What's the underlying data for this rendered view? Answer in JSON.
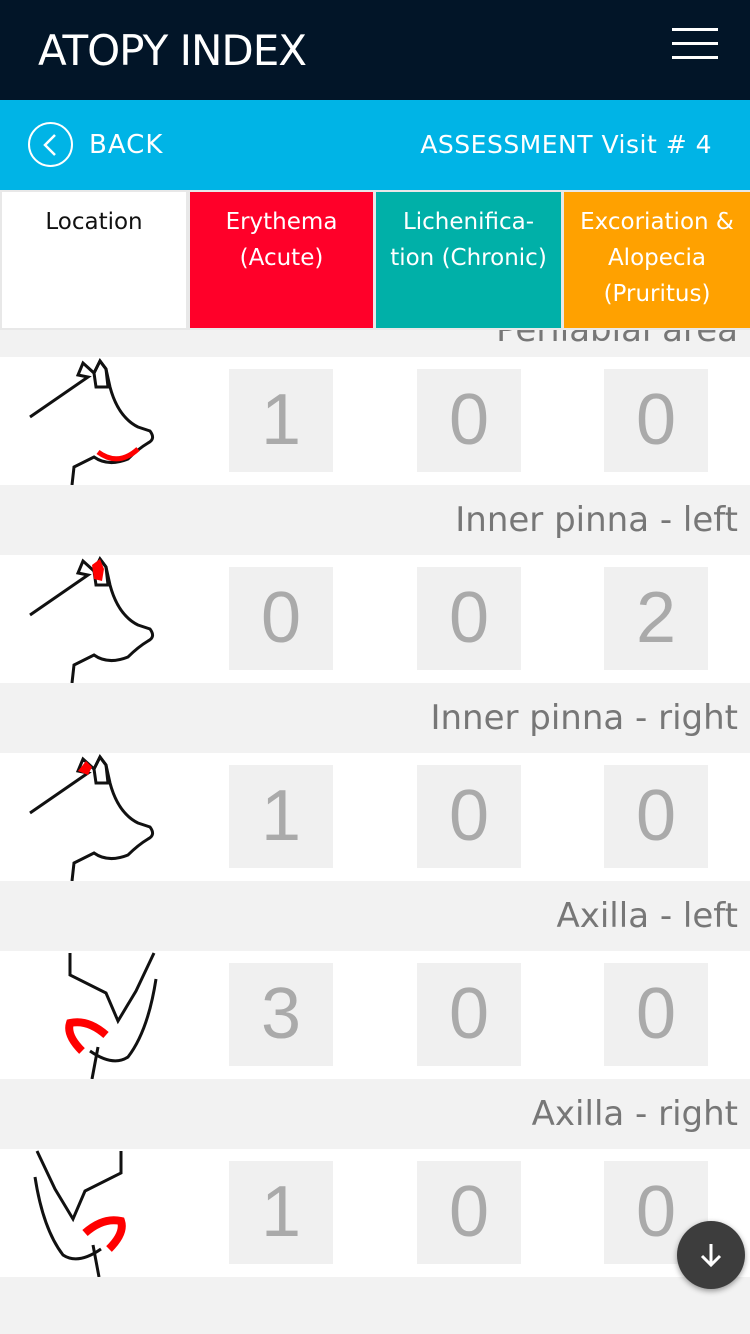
{
  "header": {
    "title": "ATOPY INDEX",
    "menu_icon": "hamburger-icon"
  },
  "nav": {
    "back_label": "BACK",
    "assessment_label": "ASSESSMENT Visit # 4"
  },
  "columns": [
    {
      "label": "Location",
      "color": "#ffffff"
    },
    {
      "label": "Erythema (Acute)",
      "color": "#ff0029"
    },
    {
      "label": "Lichenifica- tion (Chronic)",
      "color": "#00b0a8"
    },
    {
      "label": "Excoriation & Alopecia (Pruritus)",
      "color": "#ffa100"
    }
  ],
  "partial_label": "Perilabial area",
  "rows": [
    {
      "location": "Perilabial area",
      "image": "dog-head-lip",
      "values": [
        "1",
        "0",
        "0"
      ]
    },
    {
      "location": "Inner pinna - left",
      "image": "dog-head-ear-left",
      "values": [
        "0",
        "0",
        "2"
      ]
    },
    {
      "location": "Inner pinna - right",
      "image": "dog-head-ear-right",
      "values": [
        "1",
        "0",
        "0"
      ]
    },
    {
      "location": "Axilla - left",
      "image": "dog-leg-axilla-left",
      "values": [
        "3",
        "0",
        "0"
      ]
    },
    {
      "location": "Axilla - right",
      "image": "dog-leg-axilla-right",
      "values": [
        "1",
        "0",
        "0"
      ]
    }
  ],
  "scroll_button_icon": "arrow-down-icon"
}
